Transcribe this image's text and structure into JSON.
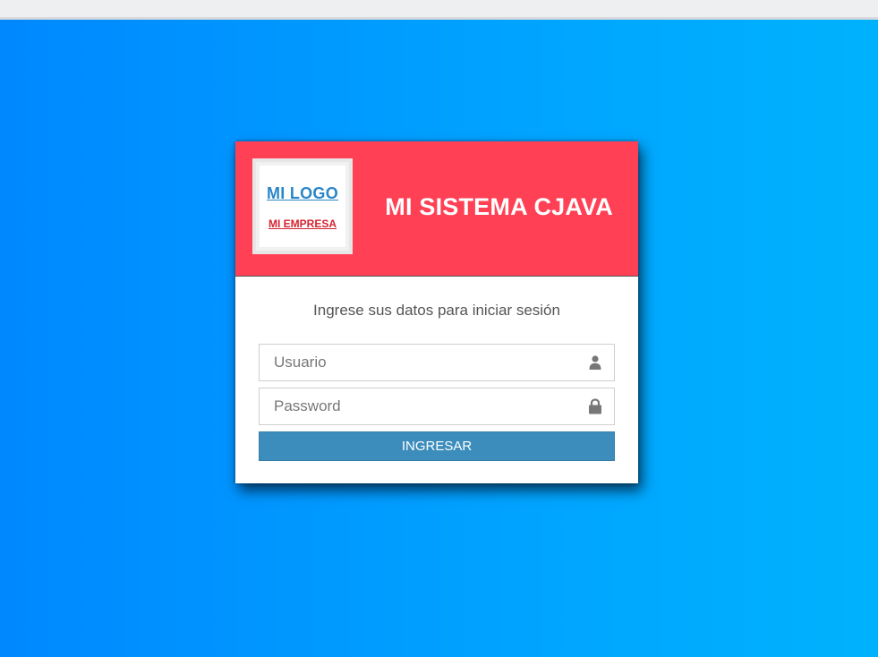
{
  "header": {
    "logo_main": "MI LOGO",
    "logo_sub": "MI EMPRESA",
    "system_title": "MI SISTEMA CJAVA"
  },
  "form": {
    "message": "Ingrese sus datos para iniciar sesión",
    "username": {
      "placeholder": "Usuario",
      "value": "",
      "icon": "user-icon"
    },
    "password": {
      "placeholder": "Password",
      "value": "",
      "icon": "lock-icon"
    },
    "submit_label": "INGRESAR"
  },
  "colors": {
    "background_start": "#0088ff",
    "background_end": "#00b2fd",
    "header_accent": "#ff4055",
    "button": "#3c8dbc",
    "logo_main": "#2a86c8",
    "logo_sub": "#d4232f"
  }
}
